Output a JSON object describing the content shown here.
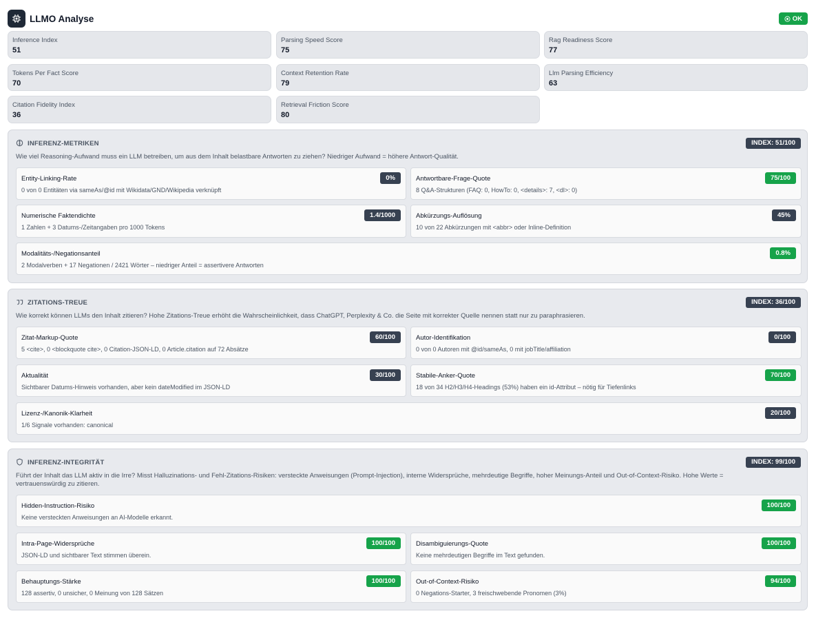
{
  "header": {
    "title": "LLMO Analyse",
    "status": "OK"
  },
  "metrics": [
    {
      "label": "Inference Index",
      "value": "51"
    },
    {
      "label": "Parsing Speed Score",
      "value": "75"
    },
    {
      "label": "Rag Readiness Score",
      "value": "77"
    },
    {
      "label": "Tokens Per Fact Score",
      "value": "70"
    },
    {
      "label": "Context Retention Rate",
      "value": "79"
    },
    {
      "label": "Llm Parsing Efficiency",
      "value": "63"
    },
    {
      "label": "Citation Fidelity Index",
      "value": "36"
    },
    {
      "label": "Retrieval Friction Score",
      "value": "80"
    }
  ],
  "sections": [
    {
      "icon": "brain-icon",
      "title": "INFERENZ-METRIKEN",
      "index": "INDEX: 51/100",
      "desc": "Wie viel Reasoning-Aufwand muss ein LLM betreiben, um aus dem Inhalt belastbare Antworten zu ziehen? Niedriger Aufwand = höhere Antwort-Qualität.",
      "cards": [
        {
          "title": "Entity-Linking-Rate",
          "badge": "0%",
          "tone": "dark",
          "sub": "0 von 0 Entitäten via sameAs/@id mit Wikidata/GND/Wikipedia verknüpft"
        },
        {
          "title": "Antwortbare-Frage-Quote",
          "badge": "75/100",
          "tone": "green",
          "sub": "8 Q&A-Strukturen (FAQ: 0, HowTo: 0, <details>: 7, <dl>: 0)"
        },
        {
          "title": "Numerische Faktendichte",
          "badge": "1.4/1000",
          "tone": "dark",
          "sub": "1 Zahlen + 3 Datums-/Zeitangaben pro 1000 Tokens"
        },
        {
          "title": "Abkürzungs-Auflösung",
          "badge": "45%",
          "tone": "dark",
          "sub": "10 von 22 Abkürzungen mit <abbr> oder Inline-Definition"
        },
        {
          "title": "Modalitäts-/Negationsanteil",
          "badge": "0.8%",
          "tone": "green",
          "sub": "2 Modalverben + 17 Negationen / 2421 Wörter – niedriger Anteil = assertivere Antworten"
        }
      ]
    },
    {
      "icon": "quote-icon",
      "title": "ZITATIONS-TREUE",
      "index": "INDEX: 36/100",
      "desc": "Wie korrekt können LLMs den Inhalt zitieren? Hohe Zitations-Treue erhöht die Wahrscheinlichkeit, dass ChatGPT, Perplexity & Co. die Seite mit korrekter Quelle nennen statt nur zu paraphrasieren.",
      "cards": [
        {
          "title": "Zitat-Markup-Quote",
          "badge": "60/100",
          "tone": "dark",
          "sub": "5 <cite>, 0 <blockquote cite>, 0 Citation-JSON-LD, 0 Article.citation auf 72 Absätze"
        },
        {
          "title": "Autor-Identifikation",
          "badge": "0/100",
          "tone": "dark",
          "sub": "0 von 0 Autoren mit @id/sameAs, 0 mit jobTitle/affiliation"
        },
        {
          "title": "Aktualität",
          "badge": "30/100",
          "tone": "dark",
          "sub": "Sichtbarer Datums-Hinweis vorhanden, aber kein dateModified im JSON-LD"
        },
        {
          "title": "Stabile-Anker-Quote",
          "badge": "70/100",
          "tone": "green",
          "sub": "18 von 34 H2/H3/H4-Headings (53%) haben ein id-Attribut – nötig für Tiefenlinks"
        },
        {
          "title": "Lizenz-/Kanonik-Klarheit",
          "badge": "20/100",
          "tone": "dark",
          "sub": "1/6 Signale vorhanden: canonical"
        }
      ]
    },
    {
      "icon": "shield-icon",
      "title": "INFERENZ-INTEGRITÄT",
      "index": "INDEX: 99/100",
      "desc": "Führt der Inhalt das LLM aktiv in die Irre? Misst Halluzinations- und Fehl-Zitations-Risiken: versteckte Anweisungen (Prompt-Injection), interne Widersprüche, mehrdeutige Begriffe, hoher Meinungs-Anteil und Out-of-Context-Risiko. Hohe Werte = vertrauenswürdig zu zitieren.",
      "cards": [
        {
          "title": "Hidden-Instruction-Risiko",
          "badge": "100/100",
          "tone": "green",
          "sub": "Keine versteckten Anweisungen an AI-Modelle erkannt."
        },
        {
          "title": "Intra-Page-Widersprüche",
          "badge": "100/100",
          "tone": "green",
          "sub": "JSON-LD und sichtbarer Text stimmen überein."
        },
        {
          "title": "Disambiguierungs-Quote",
          "badge": "100/100",
          "tone": "green",
          "sub": "Keine mehrdeutigen Begriffe im Text gefunden."
        },
        {
          "title": "Behauptungs-Stärke",
          "badge": "100/100",
          "tone": "green",
          "sub": "128 assertiv, 0 unsicher, 0 Meinung von 128 Sätzen"
        },
        {
          "title": "Out-of-Context-Risiko",
          "badge": "94/100",
          "tone": "green",
          "sub": "0 Negations-Starter, 3 freischwebende Pronomen (3%)"
        }
      ]
    }
  ]
}
